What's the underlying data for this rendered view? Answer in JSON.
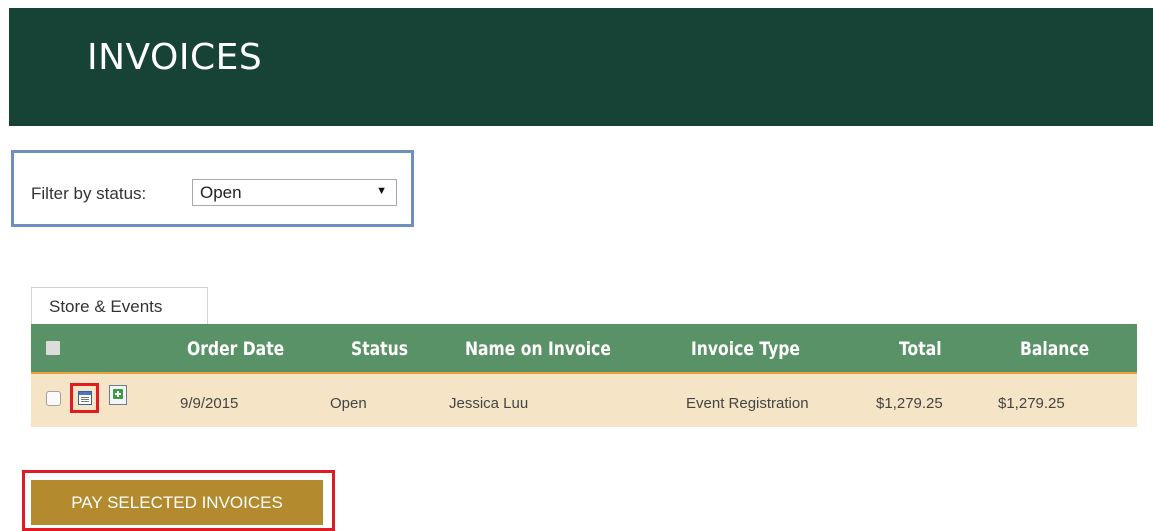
{
  "header": {
    "title": "INVOICES"
  },
  "filter": {
    "label": "Filter by status:",
    "selected": "Open"
  },
  "tabs": [
    {
      "label": "Store & Events"
    }
  ],
  "table": {
    "columns": [
      "Order Date",
      "Status",
      "Name on Invoice",
      "Invoice Type",
      "Total",
      "Balance"
    ],
    "rows": [
      {
        "order_date": "9/9/2015",
        "status": "Open",
        "name": "Jessica Luu",
        "invoice_type": "Event Registration",
        "total": "$1,279.25",
        "balance": "$1,279.25"
      }
    ]
  },
  "actions": {
    "pay_label": "PAY SELECTED INVOICES"
  },
  "colors": {
    "header_bg": "#174236",
    "grid_header_bg": "#5a9267",
    "row_bg": "#f5e5c6",
    "button_bg": "#b38a2d",
    "highlight_red": "#e01b22",
    "highlight_blue": "#6f8fc0"
  },
  "icons": {
    "row_view": "invoice-details-icon",
    "row_add": "add-to-calendar-icon",
    "select_arrow": "chevron-down-icon"
  }
}
